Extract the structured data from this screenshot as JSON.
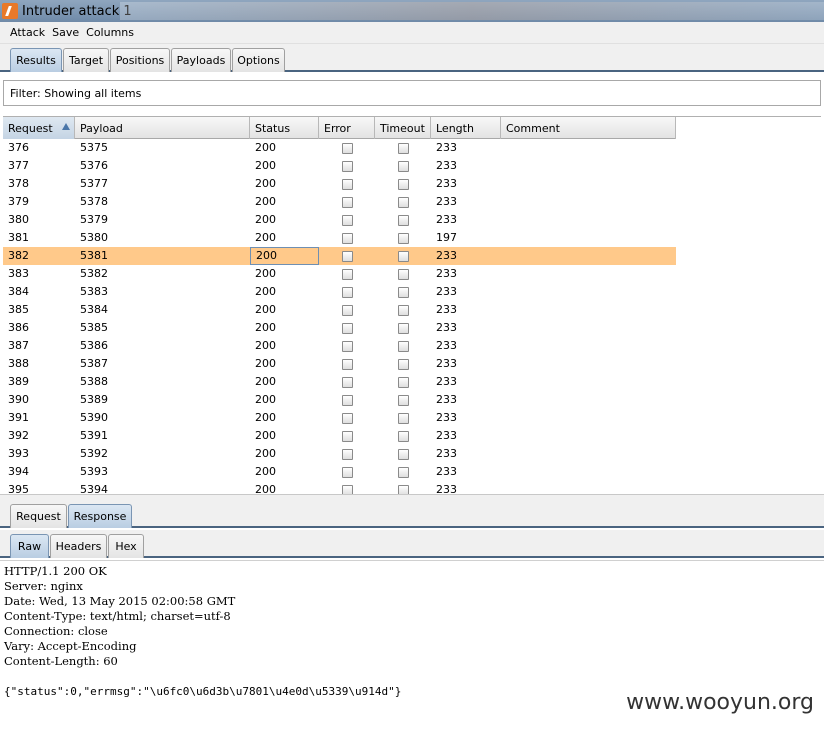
{
  "window": {
    "title": "Intruder attack 1"
  },
  "menu": [
    "Attack",
    "Save",
    "Columns"
  ],
  "main_tabs": [
    {
      "label": "Results",
      "active": true
    },
    {
      "label": "Target",
      "active": false
    },
    {
      "label": "Positions",
      "active": false
    },
    {
      "label": "Payloads",
      "active": false
    },
    {
      "label": "Options",
      "active": false
    }
  ],
  "filter": {
    "text": "Filter: Showing all items"
  },
  "table": {
    "columns": [
      "Request",
      "Payload",
      "Status",
      "Error",
      "Timeout",
      "Length",
      "Comment"
    ],
    "sorted_column": "Request",
    "selected_request": "382",
    "rows": [
      {
        "request": "376",
        "payload": "5375",
        "status": "200",
        "length": "233",
        "comment": ""
      },
      {
        "request": "377",
        "payload": "5376",
        "status": "200",
        "length": "233",
        "comment": ""
      },
      {
        "request": "378",
        "payload": "5377",
        "status": "200",
        "length": "233",
        "comment": ""
      },
      {
        "request": "379",
        "payload": "5378",
        "status": "200",
        "length": "233",
        "comment": ""
      },
      {
        "request": "380",
        "payload": "5379",
        "status": "200",
        "length": "233",
        "comment": ""
      },
      {
        "request": "381",
        "payload": "5380",
        "status": "200",
        "length": "197",
        "comment": ""
      },
      {
        "request": "382",
        "payload": "5381",
        "status": "200",
        "length": "233",
        "comment": ""
      },
      {
        "request": "383",
        "payload": "5382",
        "status": "200",
        "length": "233",
        "comment": ""
      },
      {
        "request": "384",
        "payload": "5383",
        "status": "200",
        "length": "233",
        "comment": ""
      },
      {
        "request": "385",
        "payload": "5384",
        "status": "200",
        "length": "233",
        "comment": ""
      },
      {
        "request": "386",
        "payload": "5385",
        "status": "200",
        "length": "233",
        "comment": ""
      },
      {
        "request": "387",
        "payload": "5386",
        "status": "200",
        "length": "233",
        "comment": ""
      },
      {
        "request": "388",
        "payload": "5387",
        "status": "200",
        "length": "233",
        "comment": ""
      },
      {
        "request": "389",
        "payload": "5388",
        "status": "200",
        "length": "233",
        "comment": ""
      },
      {
        "request": "390",
        "payload": "5389",
        "status": "200",
        "length": "233",
        "comment": ""
      },
      {
        "request": "391",
        "payload": "5390",
        "status": "200",
        "length": "233",
        "comment": ""
      },
      {
        "request": "392",
        "payload": "5391",
        "status": "200",
        "length": "233",
        "comment": ""
      },
      {
        "request": "393",
        "payload": "5392",
        "status": "200",
        "length": "233",
        "comment": ""
      },
      {
        "request": "394",
        "payload": "5393",
        "status": "200",
        "length": "233",
        "comment": ""
      },
      {
        "request": "395",
        "payload": "5394",
        "status": "200",
        "length": "233",
        "comment": ""
      }
    ]
  },
  "detail_tabs": [
    {
      "label": "Request",
      "active": false
    },
    {
      "label": "Response",
      "active": true
    }
  ],
  "view_tabs": [
    {
      "label": "Raw",
      "active": true
    },
    {
      "label": "Headers",
      "active": false
    },
    {
      "label": "Hex",
      "active": false
    }
  ],
  "response": {
    "headers": [
      "HTTP/1.1 200 OK",
      "Server: nginx",
      "Date: Wed, 13 May 2015 02:00:58 GMT",
      "Content-Type: text/html; charset=utf-8",
      "Connection: close",
      "Vary: Accept-Encoding",
      "Content-Length: 60"
    ],
    "body": "{\"status\":0,\"errmsg\":\"\\u6fc0\\u6d3b\\u7801\\u4e0d\\u5339\\u914d\"}"
  },
  "watermark": "www.wooyun.org",
  "colors": {
    "selected_row": "#ffc98a",
    "tab_active": "#c4d4e4",
    "tab_underline": "#4a6480"
  }
}
